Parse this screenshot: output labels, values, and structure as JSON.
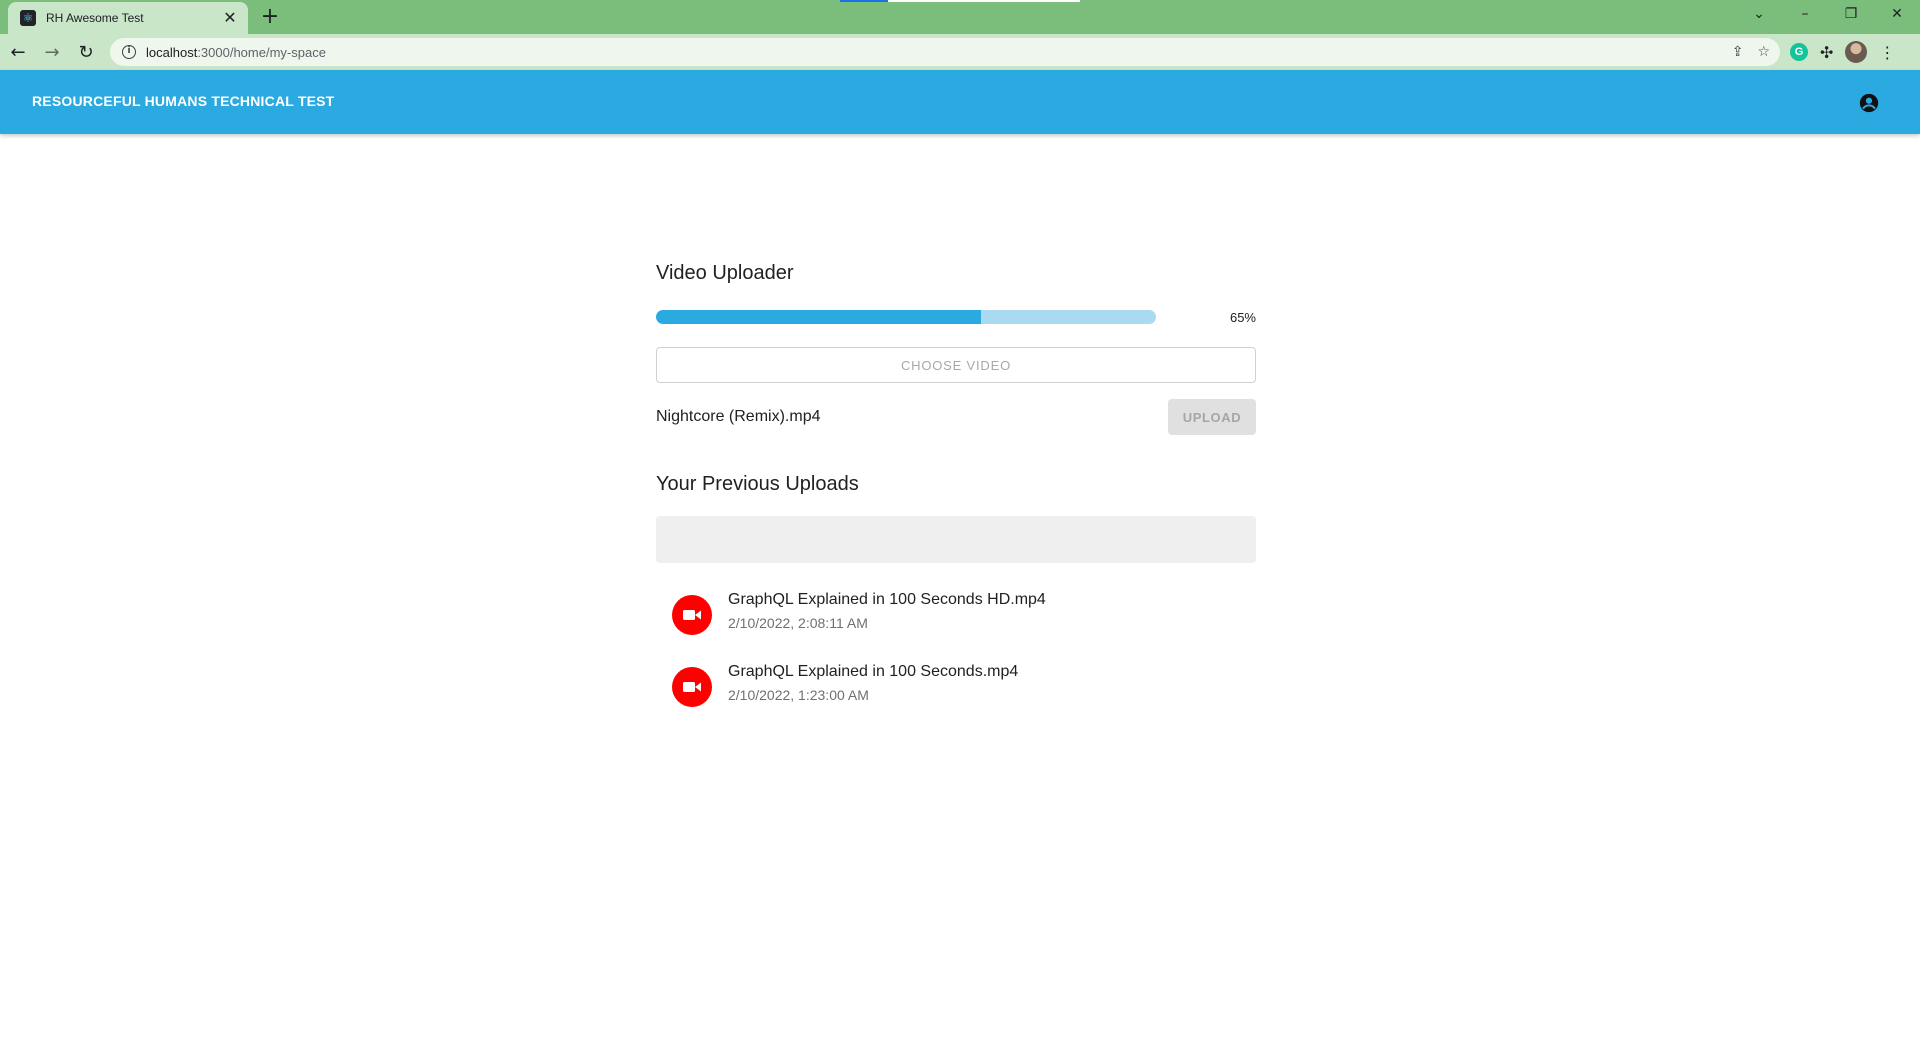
{
  "browser": {
    "tab_title": "RH Awesome Test",
    "tab_close": "✕",
    "new_tab": "+",
    "url_host": "localhost",
    "url_path": ":3000/home/my-space",
    "window_controls": {
      "list_tabs": "⌄",
      "minimize": "–",
      "restore": "❐",
      "close": "✕"
    },
    "nav": {
      "back": "←",
      "forward": "→",
      "reload": "↻"
    },
    "icons": [
      "info-icon",
      "share-icon",
      "star-icon",
      "grammarly-icon",
      "extensions-icon",
      "profile-avatar",
      "menu-icon"
    ]
  },
  "appbar": {
    "title": "RESOURCEFUL HUMANS TECHNICAL TEST",
    "color": "#2ba9e1"
  },
  "uploader": {
    "title": "Video Uploader",
    "progress_percent": 65,
    "progress_label": "65%",
    "choose_label": "CHOOSE VIDEO",
    "file_name": "Nightcore (Remix).mp4",
    "upload_label": "UPLOAD"
  },
  "previous": {
    "title": "Your Previous Uploads",
    "items": [
      {
        "name": "GraphQL Explained in 100 Seconds HD.mp4",
        "date": "2/10/2022, 2:08:11 AM",
        "icon": "video-camera-icon"
      },
      {
        "name": "GraphQL Explained in 100 Seconds.mp4",
        "date": "2/10/2022, 1:23:00 AM",
        "icon": "video-camera-icon"
      }
    ]
  }
}
